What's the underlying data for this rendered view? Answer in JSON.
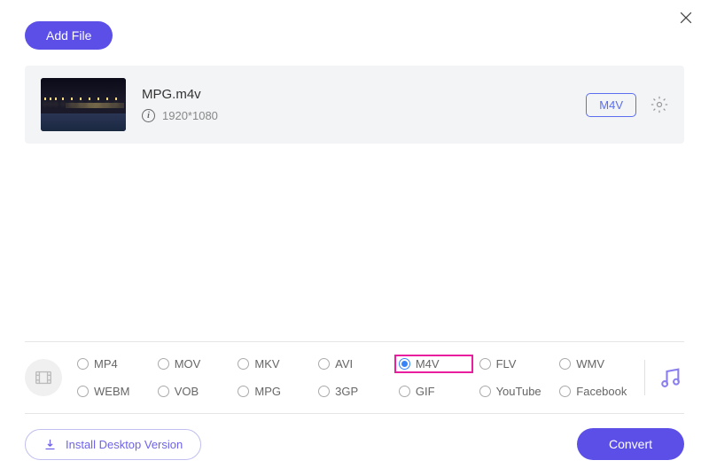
{
  "header": {
    "add_file_label": "Add File"
  },
  "file": {
    "name": "MPG.m4v",
    "resolution": "1920*1080",
    "format_badge": "M4V"
  },
  "formats": {
    "row1": [
      "MP4",
      "MOV",
      "MKV",
      "AVI",
      "M4V",
      "FLV",
      "WMV"
    ],
    "row2": [
      "WEBM",
      "VOB",
      "MPG",
      "3GP",
      "GIF",
      "YouTube",
      "Facebook"
    ],
    "selected": "M4V"
  },
  "footer": {
    "install_label": "Install Desktop Version",
    "convert_label": "Convert"
  }
}
